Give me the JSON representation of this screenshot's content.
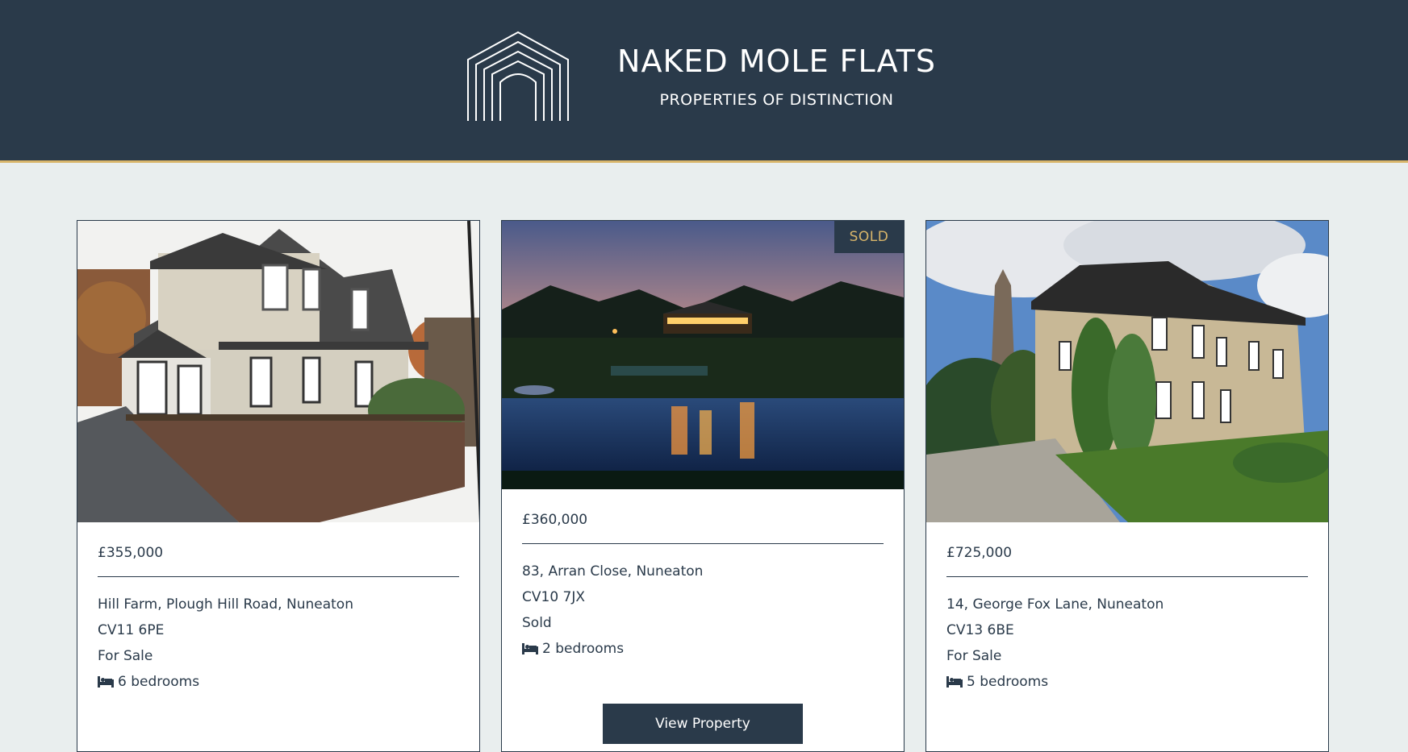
{
  "header": {
    "title": "NAKED MOLE FLATS",
    "subtitle": "PROPERTIES OF DISTINCTION",
    "logo_icon": "house-arches-logo"
  },
  "colors": {
    "header_bg": "#2a3a4a",
    "accent": "#d8b56a",
    "page_bg": "#e9eeee"
  },
  "listings": [
    {
      "price": "£355,000",
      "address": "Hill Farm, Plough Hill Road, Nuneaton",
      "postcode": "CV11 6PE",
      "status": "For Sale",
      "bedrooms": "6 bedrooms",
      "photo": "brick-detached-house-photo"
    },
    {
      "price": "£360,000",
      "address": "83, Arran Close, Nuneaton",
      "postcode": "CV10 7JX",
      "status": "Sold",
      "bedrooms": "2 bedrooms",
      "badge": "SOLD",
      "button": "View Property",
      "photo": "lakeside-house-dusk-photo"
    },
    {
      "price": "£725,000",
      "address": "14, George Fox Lane, Nuneaton",
      "postcode": "CV13 6BE",
      "status": "For Sale",
      "bedrooms": "5 bedrooms",
      "photo": "victorian-mansion-photo"
    }
  ]
}
